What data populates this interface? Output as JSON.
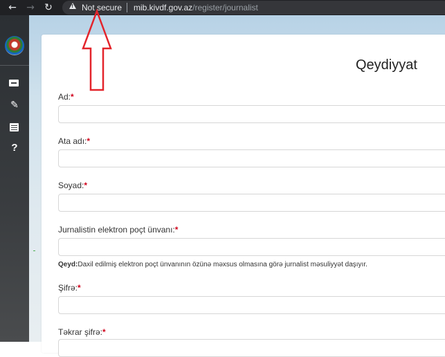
{
  "browser": {
    "back_icon": "back-arrow-icon",
    "forward_icon": "forward-arrow-icon",
    "reload_icon": "reload-icon",
    "security_label": "Not secure",
    "url_host": "mib.kivdf.gov.az",
    "url_path": "/register/journalist"
  },
  "sidebar": {
    "icons": [
      "emblem-logo",
      "id-card-icon",
      "pen-icon",
      "list-icon",
      "help-icon"
    ]
  },
  "form": {
    "title": "Qeydiyyat",
    "required_mark": "*",
    "fields": [
      {
        "label": "Ad:"
      },
      {
        "label": "Ata adı:"
      },
      {
        "label": "Soyad:"
      },
      {
        "label": "Jurnalistin elektron poçt ünvanı:"
      },
      {
        "label": "Şifrə:"
      },
      {
        "label": "Təkrar şifrə:"
      }
    ],
    "note_prefix": "Qeyd:",
    "note_text": "Daxil edilmiş elektron poçt ünvanının özünə məxsus olmasına görə jurnalist məsuliyyət daşıyır."
  },
  "colors": {
    "required": "#d0021b",
    "annotation_arrow": "#e3242b",
    "browser_bar": "#202124"
  }
}
